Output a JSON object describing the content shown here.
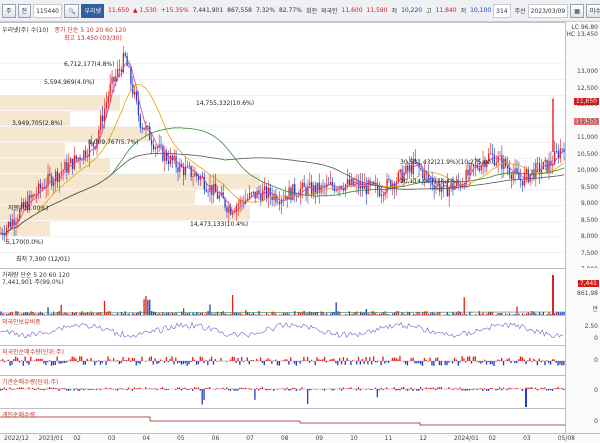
{
  "toolbar": {
    "view_label": "주",
    "mode_label": "전",
    "code": "115440",
    "name": "우리넷",
    "price": "11,650",
    "change": "▲ 1,530",
    "change_pct": "+15.35%",
    "turnover_a": "7,441,901",
    "turnover_b": "867,558",
    "pct_b": "7.32%",
    "ratio": "82.77%",
    "ratio_label": "회전",
    "credit_label": "외국인",
    "open": "11,600",
    "high": "11,590",
    "low_label": "저",
    "low": "10,220",
    "close_label": "고",
    "close": "11,840",
    "prev_label": "저",
    "prev": "10,100",
    "period": "314",
    "period_unit": "주선",
    "date": "2023/03/09",
    "btn_a": "미수",
    "btn_b": "미도"
  },
  "ticker": {
    "t1": "우리넷(주)",
    "t2": "수(10)",
    "t3": "종가 단순 5 10 20 60 120",
    "t4": "최고 13,450 (03/30)",
    "right_note": "LC 96.80",
    "right_note2": "HC 13,450"
  },
  "annotations": {
    "a1": "6,712,177(4.8%)",
    "a2": "5,594,969(4.0%)",
    "a3": "14,755,332(10.6%)",
    "a4": "3,949,705(2.8%)",
    "a5": "8,009,767(5.7%)",
    "a6": "30,531,432(21.9%)(10,275.00)",
    "a7": "20,114,007(14.4%)",
    "a8": "14,473,133(10.4%)",
    "a9": "최저 7,300 (12/01)",
    "a10": "5,170(0.0%)",
    "a11": "저평가(0.00%)"
  },
  "price_axis": [
    "13,000",
    "12,500",
    "12,000",
    "11,500",
    "11,000",
    "10,500",
    "10,000",
    "9,500",
    "9,000",
    "8,500",
    "8,000",
    "7,500",
    "7,000"
  ],
  "price_tags": {
    "current": "11,650",
    "bid": "11,650"
  },
  "volume": {
    "title": "거래량 단순 5 20 60 120",
    "sub": "7,441,901 주(99.0%)",
    "axis_top": "7,441",
    "axis_mid": "861,98",
    "axis_label": "만"
  },
  "ind1": {
    "title": "외국인보유비중",
    "axis": "2.50",
    "axis2": "0"
  },
  "ind2": {
    "title": "외국인순매수량(단위:주)",
    "axis": "0"
  },
  "ind3": {
    "title": "기관순매수량(단위:주)",
    "axis": "0"
  },
  "ind4": {
    "title": "개인순매수량",
    "axis": "0"
  },
  "dates": [
    "2022/12",
    "2023/01",
    "02",
    "03",
    "04",
    "05",
    "06",
    "07",
    "08",
    "09",
    "10",
    "11",
    "12",
    "2024/01",
    "02",
    "03",
    "05/08"
  ]
}
